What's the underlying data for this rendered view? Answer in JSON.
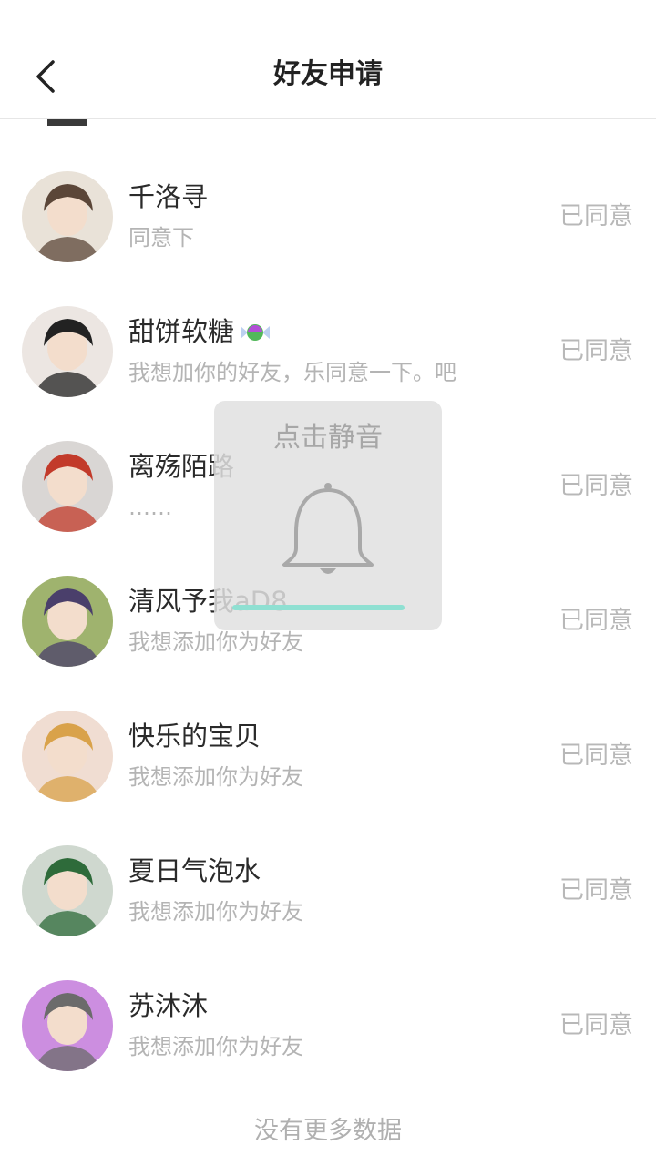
{
  "header": {
    "title": "好友申请",
    "back_icon": "chevron-left-icon"
  },
  "requests": [
    {
      "name": "千洛寻",
      "message": "同意下",
      "status": "已同意",
      "avatar_bg": "#e9e2d8",
      "avatar_fg": "#5b4638"
    },
    {
      "name": "甜饼软糖",
      "message": "我想加你的好友，乐同意一下。吧",
      "status": "已同意",
      "avatar_bg": "#ece6e2",
      "avatar_fg": "#222222",
      "name_icon": "candy-icon"
    },
    {
      "name": "离殇陌路",
      "message": "……",
      "status": "已同意",
      "avatar_bg": "#d9d6d4",
      "avatar_fg": "#c23a2a"
    },
    {
      "name": "清风予我aD8",
      "message": "我想添加你为好友",
      "status": "已同意",
      "avatar_bg": "#9fb36e",
      "avatar_fg": "#4a3f6b"
    },
    {
      "name": "快乐的宝贝",
      "message": "我想添加你为好友",
      "status": "已同意",
      "avatar_bg": "#f0ddd2",
      "avatar_fg": "#d9a24a"
    },
    {
      "name": "夏日气泡水",
      "message": "我想添加你为好友",
      "status": "已同意",
      "avatar_bg": "#cfd8cf",
      "avatar_fg": "#2e6b3a"
    },
    {
      "name": "苏沐沐",
      "message": "我想添加你为好友",
      "status": "已同意",
      "avatar_bg": "#cc8ee0",
      "avatar_fg": "#6b6b6b"
    }
  ],
  "footer": {
    "text": "没有更多数据"
  },
  "mute_overlay": {
    "title": "点击静音",
    "icon": "bell-icon",
    "progress": 0.9,
    "progress_color": "#8fe0d2"
  }
}
